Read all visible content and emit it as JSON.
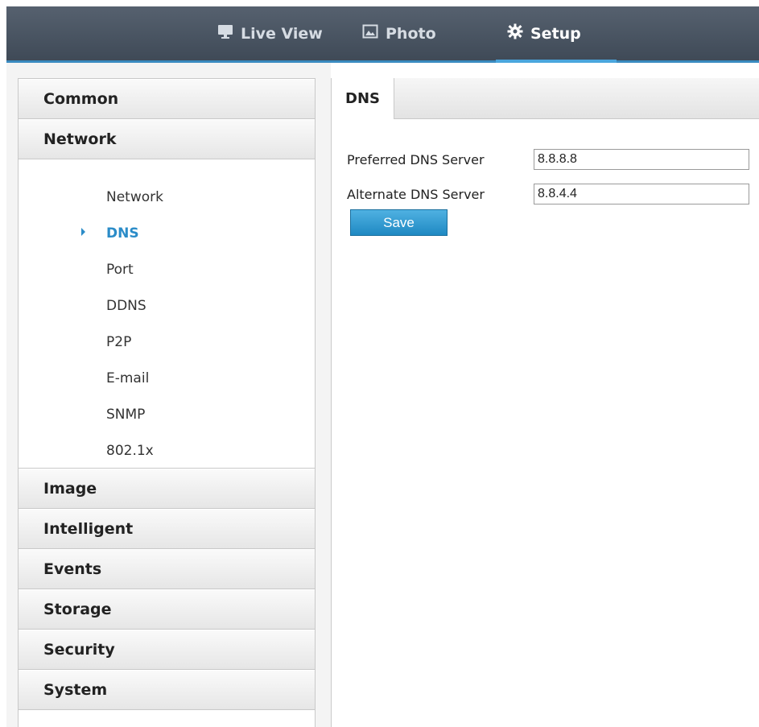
{
  "topnav": {
    "items": [
      {
        "label": "Live View",
        "icon": "monitor-icon"
      },
      {
        "label": "Photo",
        "icon": "image-icon"
      },
      {
        "label": "Setup",
        "icon": "gear-icon",
        "active": true
      }
    ]
  },
  "sidebar": {
    "categories_top": [
      "Common",
      "Network"
    ],
    "network_items": [
      "Network",
      "DNS",
      "Port",
      "DDNS",
      "P2P",
      "E-mail",
      "SNMP",
      "802.1x"
    ],
    "active_item": "DNS",
    "categories_bottom": [
      "Image",
      "Intelligent",
      "Events",
      "Storage",
      "Security",
      "System"
    ]
  },
  "content": {
    "tab": "DNS",
    "fields": [
      {
        "label": "Preferred DNS Server",
        "value": "8.8.8.8"
      },
      {
        "label": "Alternate DNS Server",
        "value": "8.8.4.4"
      }
    ],
    "save_label": "Save"
  },
  "colors": {
    "accent": "#2b8cc8",
    "topbar": "#4a5563",
    "button": "#2a94cc"
  }
}
